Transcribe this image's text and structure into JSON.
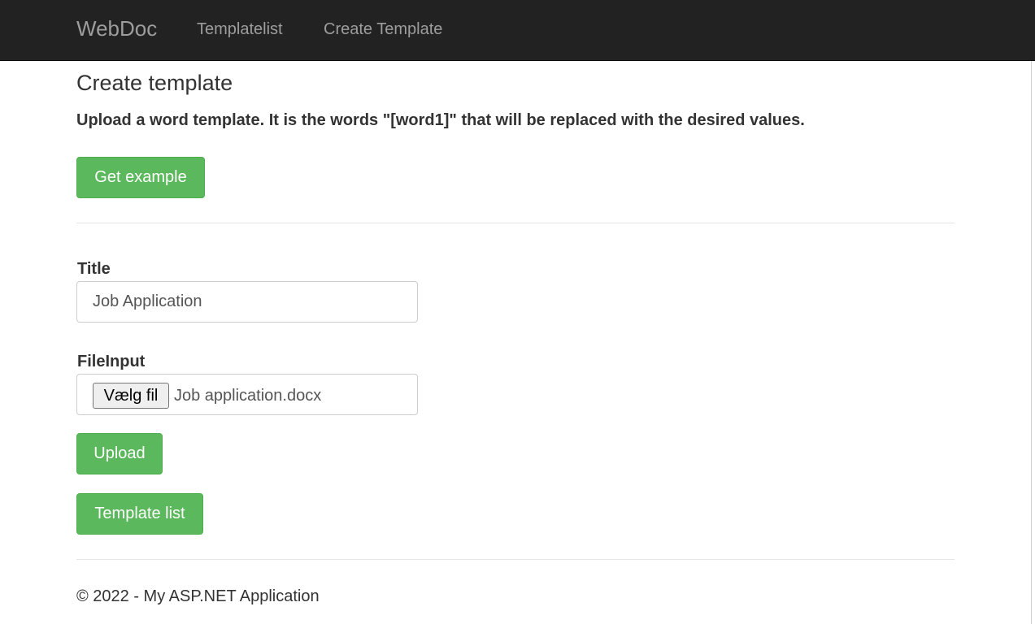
{
  "navbar": {
    "brand": "WebDoc",
    "links": [
      "Templatelist",
      "Create Template"
    ]
  },
  "page": {
    "title": "Create template",
    "description": "Upload a word template. It is the words \"[word1]\" that will be replaced with the desired values.",
    "get_example_label": "Get example"
  },
  "form": {
    "title_label": "Title",
    "title_value": "Job Application",
    "file_label": "FileInput",
    "file_button_label": "Vælg fil",
    "file_name": "Job application.docx",
    "upload_label": "Upload",
    "template_list_label": "Template list"
  },
  "footer": {
    "text": "© 2022 - My ASP.NET Application"
  },
  "colors": {
    "navbar_bg": "#222222",
    "nav_text": "#9d9d9d",
    "button_green": "#5cb85c",
    "text": "#333333"
  }
}
